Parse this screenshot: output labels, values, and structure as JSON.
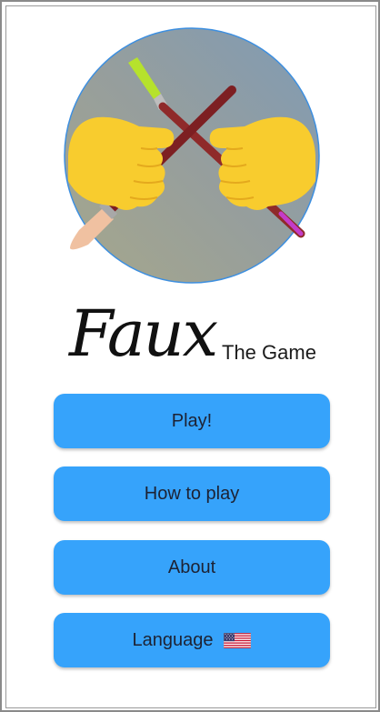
{
  "app": {
    "title": "Faux",
    "subtitle": "The Game",
    "logo_icon": "crossed-paintbrushes-fists-icon"
  },
  "menu": {
    "play_label": "Play!",
    "how_to_play_label": "How to play",
    "about_label": "About",
    "language_label": "Language",
    "language_flag_icon": "us-flag-icon"
  },
  "colors": {
    "button": "#36a3fb",
    "button_text": "#1d2233",
    "logo_circle": "#8c9aa6",
    "fist": "#f8cc2e",
    "brush_handle": "#8f2a2a"
  }
}
